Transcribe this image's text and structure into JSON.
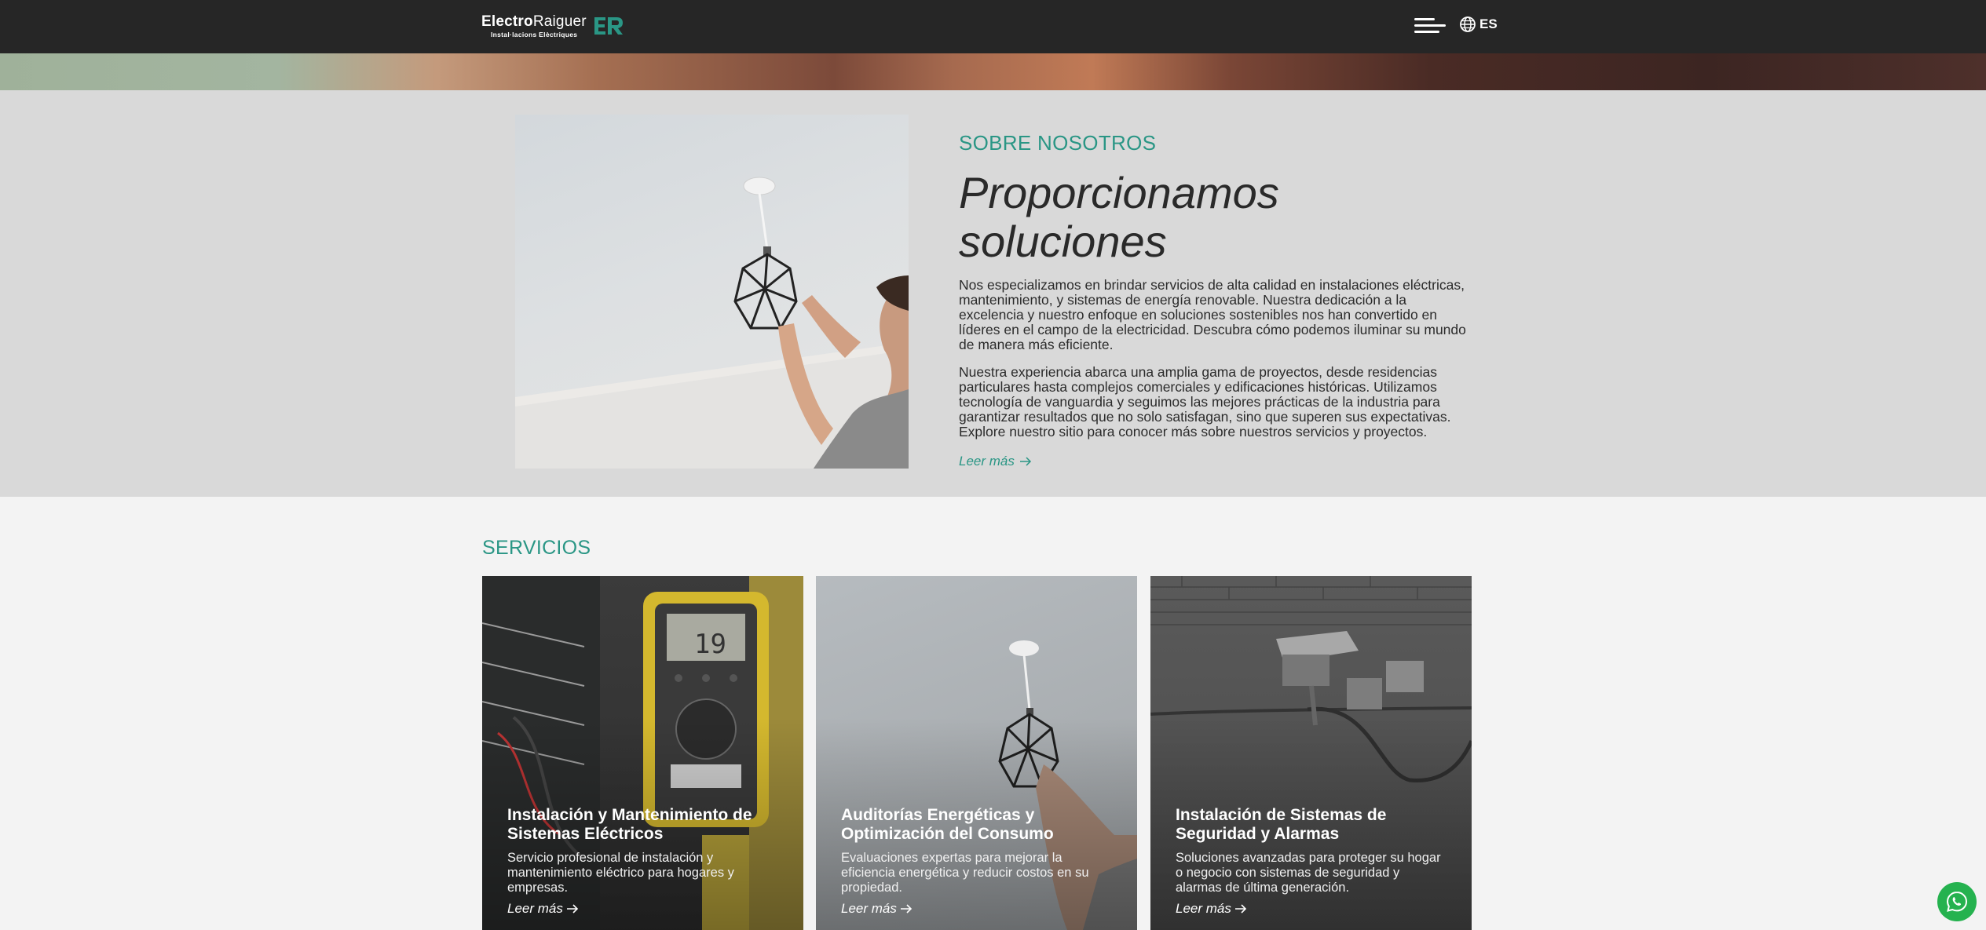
{
  "header": {
    "logo_bold": "Electro",
    "logo_regular": "Raiguer",
    "logo_sub": "Instal·lacions Elèctriques",
    "logo_mark": "ER",
    "lang": "ES",
    "menu_icon": "hamburger-menu-icon",
    "lang_icon": "globe-icon"
  },
  "about": {
    "kicker": "SOBRE NOSOTROS",
    "title": "Proporcionamos soluciones",
    "paragraph1": "Nos especializamos en brindar servicios de alta calidad en instalaciones eléctricas, mantenimiento, y sistemas de energía renovable. Nuestra dedicación a la excelencia y nuestro enfoque en soluciones sostenibles nos han convertido en líderes en el campo de la electricidad. Descubra cómo podemos iluminar su mundo de manera más eficiente.",
    "paragraph2": "Nuestra experiencia abarca una amplia gama de proyectos, desde residencias particulares hasta complejos comerciales y edificaciones históricas. Utilizamos tecnología de vanguardia y seguimos las mejores prácticas de la industria para garantizar resultados que no solo satisfagan, sino que superen sus expectativas. Explore nuestro sitio para conocer más sobre nuestros servicios y proyectos.",
    "more": "Leer más"
  },
  "services": {
    "title": "SERVICIOS",
    "cards": [
      {
        "title": "Instalación y Mantenimiento de Sistemas Eléctricos",
        "desc": "Servicio profesional de instalación y mantenimiento eléctrico para hogares y empresas.",
        "more": "Leer más",
        "multimeter_reading": "19"
      },
      {
        "title": "Auditorías Energéticas y Optimización del Consumo",
        "desc": "Evaluaciones expertas para mejorar la eficiencia energética y reducir costos en su propiedad.",
        "more": "Leer más"
      },
      {
        "title": "Instalación de Sistemas de Seguridad y Alarmas",
        "desc": "Soluciones avanzadas para proteger su hogar o negocio con sistemas de seguridad y alarmas de última generación.",
        "more": "Leer más"
      }
    ]
  },
  "colors": {
    "accent": "#2a9685",
    "header_bg": "#262626",
    "about_bg": "#d9d9d9",
    "page_bg": "#f3f3f3",
    "whatsapp": "#25b24f"
  },
  "floating": {
    "icon": "whatsapp-icon"
  }
}
